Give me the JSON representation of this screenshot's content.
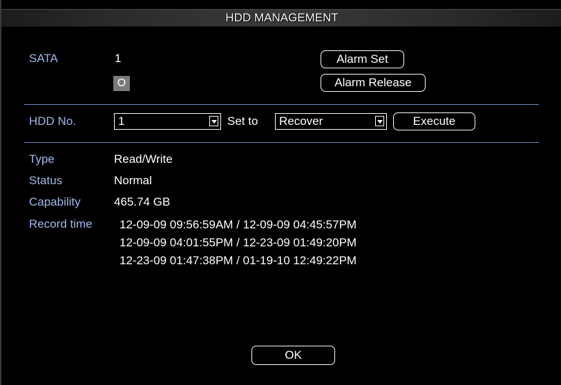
{
  "window": {
    "title": "HDD MANAGEMENT"
  },
  "sata": {
    "label": "SATA",
    "disk_number": "1",
    "disk_state": "O"
  },
  "alarm": {
    "set_label": "Alarm Set",
    "release_label": "Alarm Release"
  },
  "controls": {
    "hdd_no_label": "HDD No.",
    "hdd_no_value": "1",
    "set_to_label": "Set to",
    "set_to_value": "Recover",
    "execute_label": "Execute"
  },
  "info": {
    "type_label": "Type",
    "type_value": "Read/Write",
    "status_label": "Status",
    "status_value": "Normal",
    "capability_label": "Capability",
    "capability_value": "465.74 GB",
    "record_time_label": "Record time",
    "record_times": [
      "12-09-09 09:56:59AM / 12-09-09 04:45:57PM",
      "12-09-09 04:01:55PM / 12-23-09 01:49:20PM",
      "12-23-09 01:47:38PM / 01-19-10 12:49:22PM"
    ]
  },
  "footer": {
    "ok_label": "OK"
  },
  "colors": {
    "label": "#9fb8e6",
    "divider": "#6f8fc6",
    "background": "#000000",
    "text": "#ffffff"
  }
}
